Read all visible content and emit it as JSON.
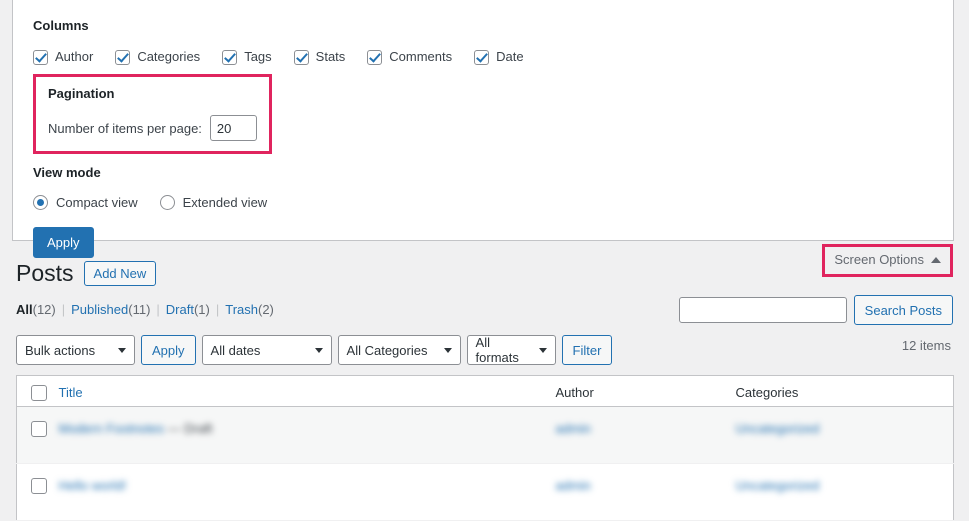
{
  "screen_options": {
    "columns_title": "Columns",
    "columns": [
      {
        "label": "Author",
        "checked": true
      },
      {
        "label": "Categories",
        "checked": true
      },
      {
        "label": "Tags",
        "checked": true
      },
      {
        "label": "Stats",
        "checked": true
      },
      {
        "label": "Comments",
        "checked": true
      },
      {
        "label": "Date",
        "checked": true
      }
    ],
    "pagination_title": "Pagination",
    "per_page_label": "Number of items per page:",
    "per_page_value": "20",
    "view_mode_title": "View mode",
    "view_modes": [
      {
        "label": "Compact view",
        "selected": true
      },
      {
        "label": "Extended view",
        "selected": false
      }
    ],
    "apply_label": "Apply",
    "highlight_color": "#e0245e"
  },
  "screen_options_tab": {
    "label": "Screen Options",
    "caret": "caret-up"
  },
  "page": {
    "title": "Posts",
    "add_new_label": "Add New"
  },
  "status_links": [
    {
      "label": "All",
      "count": "(12)",
      "current": true
    },
    {
      "label": "Published",
      "count": "(11)",
      "current": false
    },
    {
      "label": "Draft",
      "count": "(1)",
      "current": false
    },
    {
      "label": "Trash",
      "count": "(2)",
      "current": false
    }
  ],
  "search": {
    "value": "",
    "placeholder": "",
    "button_label": "Search Posts"
  },
  "items_count": "12 items",
  "toolbar": {
    "bulk_actions": "Bulk actions",
    "apply_label": "Apply",
    "all_dates": "All dates",
    "all_categories": "All Categories",
    "all_formats": "All formats",
    "filter_label": "Filter"
  },
  "table": {
    "columns": {
      "title": "Title",
      "author": "Author",
      "categories": "Categories"
    },
    "rows": [
      {
        "title": "Modern Footnotes",
        "title_suffix": " — Draft",
        "author": "admin",
        "categories": "Uncategorized"
      },
      {
        "title": "Hello world!",
        "title_suffix": "",
        "author": "admin",
        "categories": "Uncategorized"
      }
    ]
  }
}
